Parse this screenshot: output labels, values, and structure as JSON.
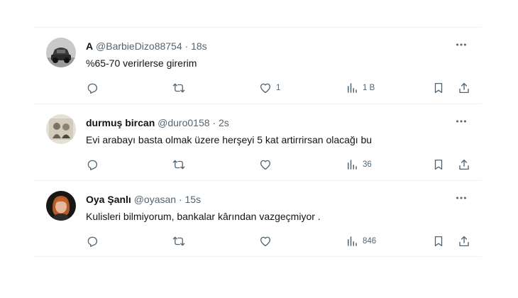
{
  "tweets": [
    {
      "name": "A",
      "handle": "@BarbieDizo88754",
      "dot": "·",
      "time": "18s",
      "text": "%65-70 verirlerse girerim",
      "likes": "1",
      "views": "1 B",
      "avatar": "avatar-car"
    },
    {
      "name": "durmuş bircan",
      "handle": "@duro0158",
      "dot": "·",
      "time": "2s",
      "text": "Evi arabayı basta olmak üzere herşeyi 5 kat artirrirsan olacağı bu",
      "likes": "",
      "views": "36",
      "avatar": "avatar-photo"
    },
    {
      "name": "Oya Şanlı",
      "handle": "@oyasan",
      "dot": "·",
      "time": "15s",
      "text": "Kulisleri bilmiyorum, bankalar kârından vazgeçmiyor .",
      "likes": "",
      "views": "846",
      "avatar": "avatar-woman"
    }
  ],
  "icons": {
    "reply": "reply-icon",
    "retweet": "retweet-icon",
    "like": "like-icon",
    "views": "views-icon",
    "bookmark": "bookmark-icon",
    "share": "share-icon",
    "more": "more-icon"
  },
  "colors": {
    "text": "#0f1419",
    "muted": "#536471",
    "border": "#eff3f4"
  }
}
